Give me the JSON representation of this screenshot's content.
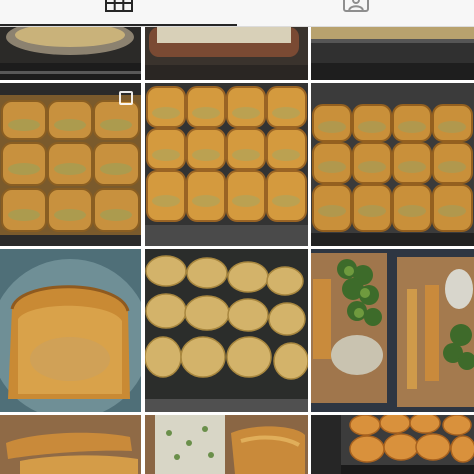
{
  "tabs": [
    {
      "name": "posts",
      "icon": "grid-icon",
      "selected": true
    },
    {
      "name": "tagged",
      "icon": "person-tag-icon",
      "selected": false
    }
  ],
  "colors": {
    "tab_background": "#f7f7f7",
    "indicator": "#262626",
    "icon": "#262626",
    "grid_gap": "#ffffff"
  },
  "posts": [
    {
      "subject": "casserole-dish",
      "icon": "casserole-icon"
    },
    {
      "subject": "casserole-pan",
      "icon": "casserole-icon"
    },
    {
      "subject": "pan-tray",
      "icon": "tray-icon"
    },
    {
      "subject": "dinner-rolls-pan",
      "icon": "rolls-icon",
      "multi": true
    },
    {
      "subject": "dinner-rolls-close",
      "icon": "rolls-icon"
    },
    {
      "subject": "dinner-rolls-tray",
      "icon": "rolls-icon"
    },
    {
      "subject": "loaf-bread",
      "icon": "bread-icon"
    },
    {
      "subject": "cookies-tray",
      "icon": "cookie-icon"
    },
    {
      "subject": "takeout-broccoli-meal",
      "icon": "meal-icon"
    },
    {
      "subject": "fried-fish-box",
      "icon": "fish-icon"
    },
    {
      "subject": "pasta-salad-fish",
      "icon": "salad-icon"
    },
    {
      "subject": "muffins-tin",
      "icon": "muffin-icon"
    }
  ]
}
